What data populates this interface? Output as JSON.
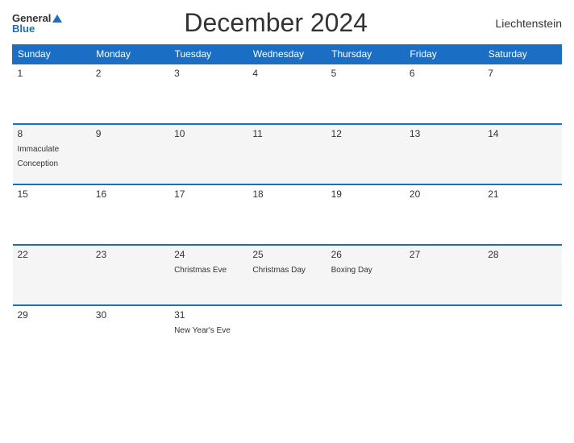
{
  "header": {
    "logo_general": "General",
    "logo_blue": "Blue",
    "title": "December 2024",
    "country": "Liechtenstein"
  },
  "weekdays": [
    "Sunday",
    "Monday",
    "Tuesday",
    "Wednesday",
    "Thursday",
    "Friday",
    "Saturday"
  ],
  "weeks": [
    [
      {
        "day": "1",
        "holiday": ""
      },
      {
        "day": "2",
        "holiday": ""
      },
      {
        "day": "3",
        "holiday": ""
      },
      {
        "day": "4",
        "holiday": ""
      },
      {
        "day": "5",
        "holiday": ""
      },
      {
        "day": "6",
        "holiday": ""
      },
      {
        "day": "7",
        "holiday": ""
      }
    ],
    [
      {
        "day": "8",
        "holiday": "Immaculate Conception"
      },
      {
        "day": "9",
        "holiday": ""
      },
      {
        "day": "10",
        "holiday": ""
      },
      {
        "day": "11",
        "holiday": ""
      },
      {
        "day": "12",
        "holiday": ""
      },
      {
        "day": "13",
        "holiday": ""
      },
      {
        "day": "14",
        "holiday": ""
      }
    ],
    [
      {
        "day": "15",
        "holiday": ""
      },
      {
        "day": "16",
        "holiday": ""
      },
      {
        "day": "17",
        "holiday": ""
      },
      {
        "day": "18",
        "holiday": ""
      },
      {
        "day": "19",
        "holiday": ""
      },
      {
        "day": "20",
        "holiday": ""
      },
      {
        "day": "21",
        "holiday": ""
      }
    ],
    [
      {
        "day": "22",
        "holiday": ""
      },
      {
        "day": "23",
        "holiday": ""
      },
      {
        "day": "24",
        "holiday": "Christmas Eve"
      },
      {
        "day": "25",
        "holiday": "Christmas Day"
      },
      {
        "day": "26",
        "holiday": "Boxing Day"
      },
      {
        "day": "27",
        "holiday": ""
      },
      {
        "day": "28",
        "holiday": ""
      }
    ],
    [
      {
        "day": "29",
        "holiday": ""
      },
      {
        "day": "30",
        "holiday": ""
      },
      {
        "day": "31",
        "holiday": "New Year's Eve"
      },
      {
        "day": "",
        "holiday": ""
      },
      {
        "day": "",
        "holiday": ""
      },
      {
        "day": "",
        "holiday": ""
      },
      {
        "day": "",
        "holiday": ""
      }
    ]
  ]
}
